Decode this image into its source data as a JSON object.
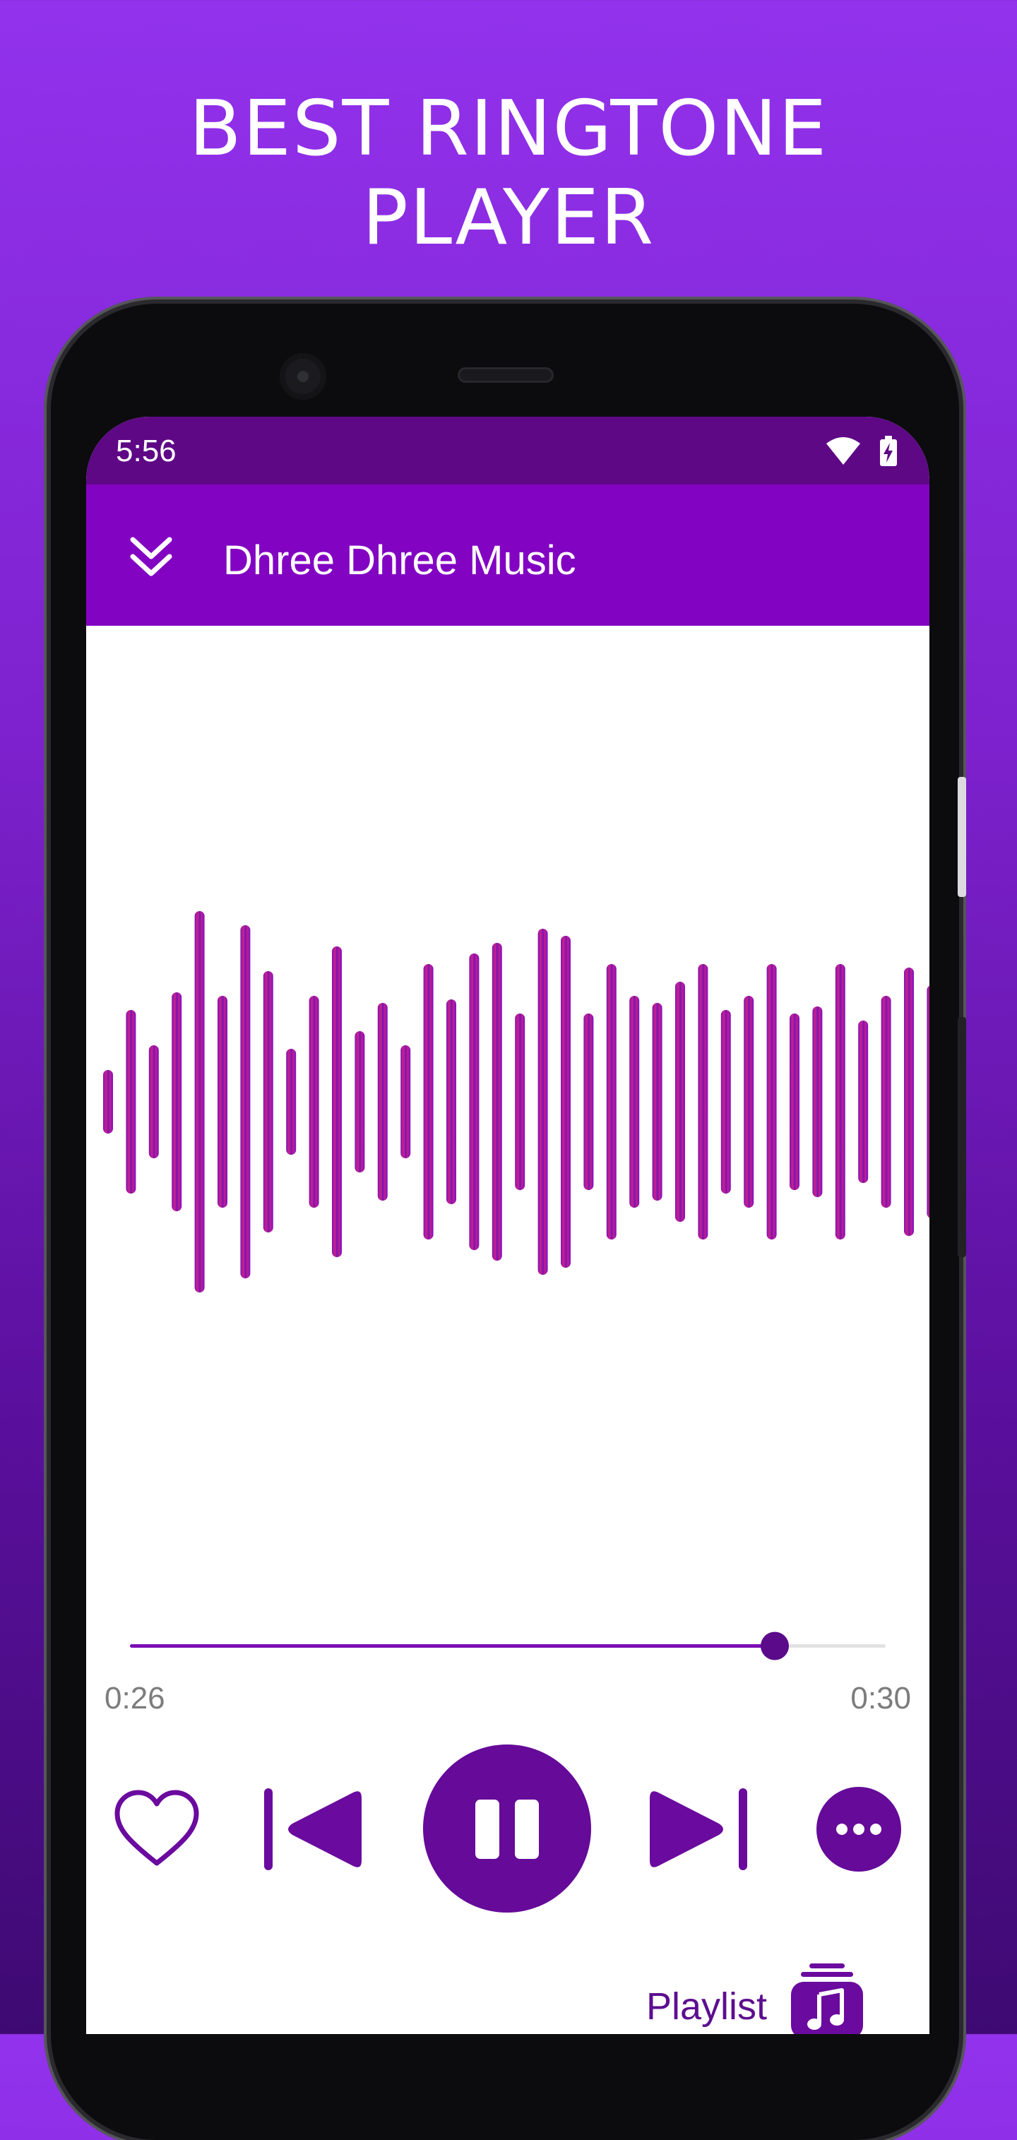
{
  "promo": {
    "headline_line1": "BEST RINGTONE",
    "headline_line2": "PLAYER"
  },
  "status_bar": {
    "time": "5:56",
    "icons": [
      "wifi-icon",
      "battery-charging-icon"
    ]
  },
  "app_bar": {
    "title": "Dhree Dhree Music",
    "collapse_icon": "double-chevron-down-icon"
  },
  "player": {
    "elapsed": "0:26",
    "duration": "0:30",
    "progress_fraction": 0.867,
    "controls": [
      "heart-icon",
      "skip-previous-icon",
      "pause-icon",
      "skip-next-icon",
      "more-dots-icon"
    ]
  },
  "footer": {
    "playlist_label": "Playlist",
    "playlist_icon": "playlist-music-icon"
  },
  "colors": {
    "accent": "#6a0a9e",
    "app_bar": "#8204c2",
    "status_bar": "#5e0886",
    "wave_pink": "#c41f8c",
    "wave_purple": "#7a0fb0"
  }
}
